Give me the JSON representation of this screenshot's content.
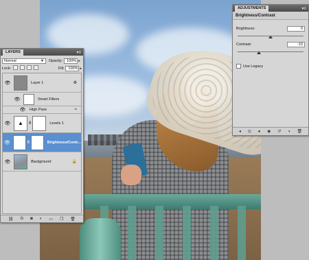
{
  "layers_panel": {
    "tab_label": "LAYERS",
    "menu_icon": "panel-menu-icon",
    "blend_mode": "Normal",
    "opacity_label": "Opacity:",
    "opacity_value": "100%",
    "lock_label": "Lock:",
    "fill_label": "Fill:",
    "fill_value": "100%",
    "layers": [
      {
        "name": "Layer 1"
      },
      {
        "name": "Smart Filters"
      },
      {
        "name": "High Pass"
      },
      {
        "name": "Levels 1"
      },
      {
        "name": "Brightness/Contr..."
      },
      {
        "name": "Background"
      }
    ],
    "footer_icons": [
      "link-icon",
      "fx-icon",
      "mask-icon",
      "adjustment-icon",
      "group-icon",
      "new-layer-icon",
      "trash-icon"
    ]
  },
  "adjustments_panel": {
    "tab_label": "ADJUSTMENTS",
    "title": "Brightness/Contrast",
    "brightness_label": "Brightness:",
    "brightness_value": "0",
    "brightness_level": 0.5,
    "contrast_label": "Contrast:",
    "contrast_value": "-10",
    "contrast_level": 0.32,
    "use_legacy_label": "Use Legacy",
    "use_legacy_checked": false,
    "footer_icons": [
      "back-icon",
      "clip-icon",
      "visibility-icon",
      "previous-state-icon",
      "reset-icon",
      "trash-icon"
    ]
  },
  "colors": {
    "selection": "#5a8fd0",
    "panel_bg": "#d6d6d6"
  }
}
